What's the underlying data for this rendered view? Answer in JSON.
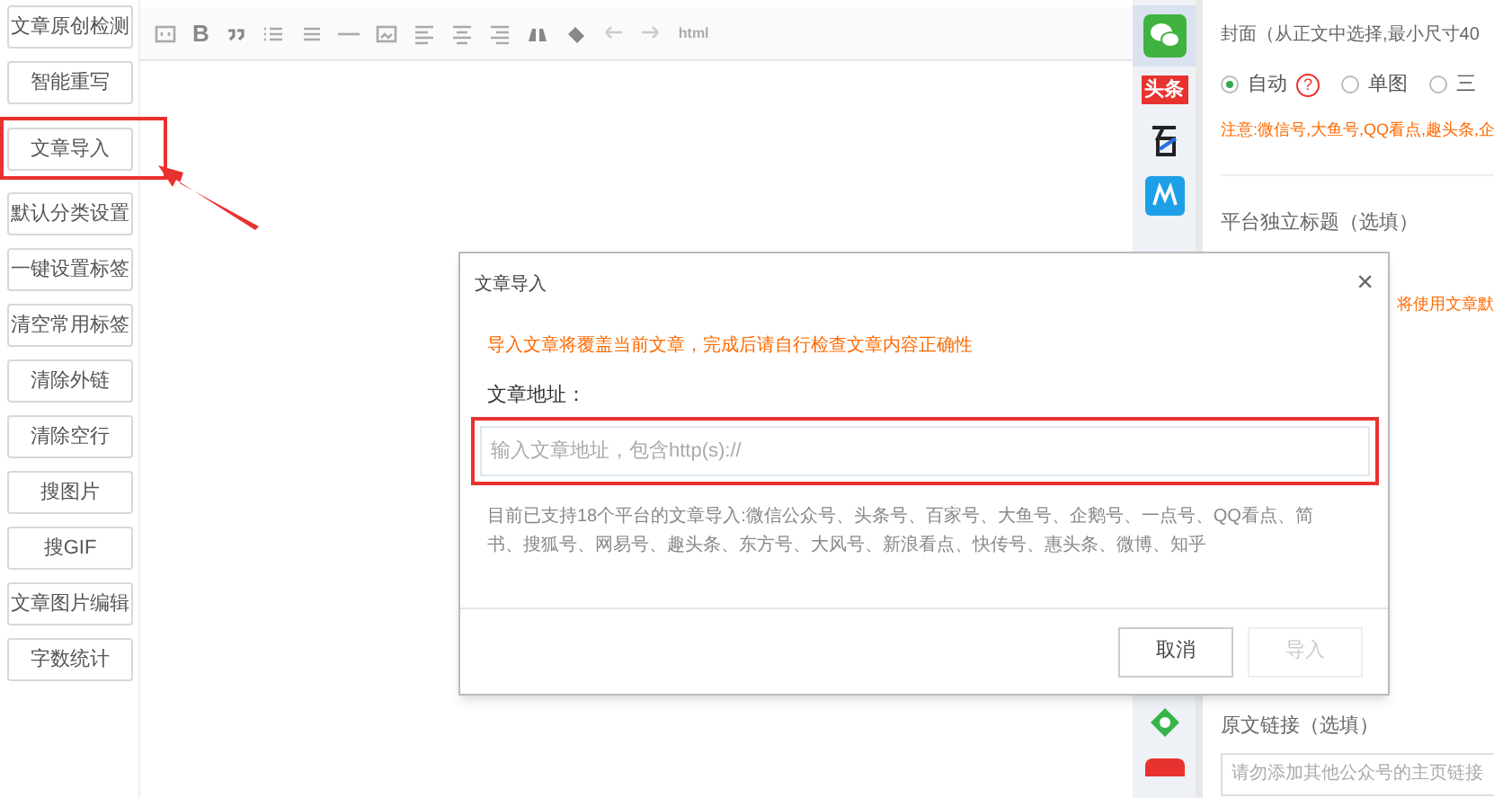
{
  "tool_buttons": [
    {
      "label": "文章原创检测",
      "highlighted": false
    },
    {
      "label": "智能重写",
      "highlighted": false
    },
    {
      "label": "文章导入",
      "highlighted": true
    },
    {
      "label": "默认分类设置",
      "highlighted": false
    },
    {
      "label": "一键设置标签",
      "highlighted": false
    },
    {
      "label": "清空常用标签",
      "highlighted": false
    },
    {
      "label": "清除外链",
      "highlighted": false
    },
    {
      "label": "清除空行",
      "highlighted": false
    },
    {
      "label": "搜图片",
      "highlighted": false
    },
    {
      "label": "搜GIF",
      "highlighted": false
    },
    {
      "label": "文章图片编辑",
      "highlighted": false
    },
    {
      "label": "字数统计",
      "highlighted": false
    }
  ],
  "toolbar": {
    "bold": "B",
    "html": "html"
  },
  "platforms": [
    {
      "kind": "wechat",
      "selected": true
    },
    {
      "kind": "toutiao",
      "label": "头条",
      "selected": false
    },
    {
      "kind": "baijia",
      "selected": false
    },
    {
      "kind": "m",
      "selected": false
    },
    {
      "kind": "eye",
      "selected": false
    },
    {
      "kind": "red",
      "selected": false
    }
  ],
  "settings": {
    "cover_label": "封面（从正文中选择,最小尺寸40",
    "cover_options": [
      {
        "label": "自动",
        "selected": true
      },
      {
        "label": "单图",
        "selected": false
      },
      {
        "label": "三",
        "selected": false
      }
    ],
    "help_mark": "?",
    "cover_note": "注意:微信号,大鱼号,QQ看点,趣头条,企",
    "title_label": "平台独立标题（选填）",
    "title_note": "将使用文章默",
    "link_label": "原文链接（选填）",
    "link_placeholder": "请勿添加其他公众号的主页链接"
  },
  "dialog": {
    "title": "文章导入",
    "close": "×",
    "warning": "导入文章将覆盖当前文章，完成后请自行检查文章内容正确性",
    "field_label": "文章地址：",
    "placeholder": "输入文章地址，包含http(s)://",
    "description": "目前已支持18个平台的文章导入:微信公众号、头条号、百家号、大鱼号、企鹅号、一点号、QQ看点、简书、搜狐号、网易号、趣头条、东方号、大风号、新浪看点、快传号、惠头条、微博、知乎",
    "buttons": [
      {
        "label": "取消",
        "disabled": false
      },
      {
        "label": "导入",
        "disabled": true
      }
    ]
  }
}
